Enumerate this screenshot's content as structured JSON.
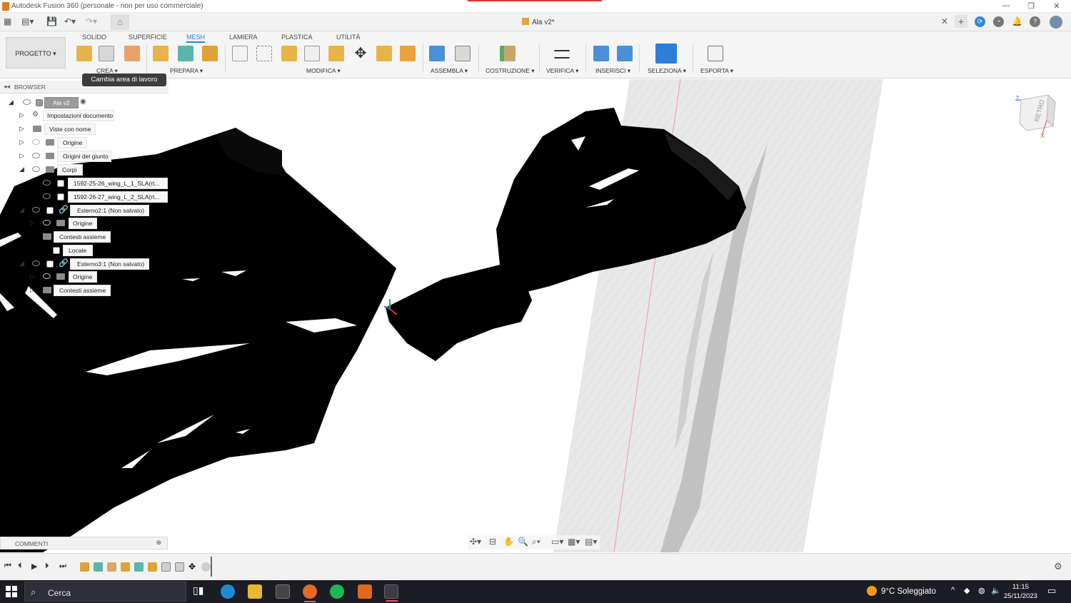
{
  "window": {
    "title": "Autodesk Fusion 360 (personale - non per uso commerciale)",
    "minimize": "—",
    "restore": "❐",
    "close": "✕"
  },
  "tabs": {
    "document_tab": "Ala v2*",
    "close": "✕",
    "plus": "+"
  },
  "ribbon": {
    "project_button": "PROGETTO ▾",
    "workspace_tabs": [
      "SOLIDO",
      "SUPERFICIE",
      "MESH",
      "LAMIERA",
      "PLASTICA",
      "UTILITÀ"
    ],
    "active_tab": "MESH",
    "groups": [
      "CREA ▾",
      "PREPARA ▾",
      "MODIFICA ▾",
      "ASSEMBLA ▾",
      "COSTRUZIONE ▾",
      "VERIFICA ▾",
      "INSERISCI ▾",
      "SELEZIONA ▾",
      "ESPORTA ▾"
    ],
    "tooltip": "Cambia area di lavoro"
  },
  "browser": {
    "title": "BROWSER",
    "items": [
      {
        "label": "Ala v2"
      },
      {
        "label": "Impostazioni documento"
      },
      {
        "label": "Viste con nome"
      },
      {
        "label": "Origine"
      },
      {
        "label": "Origini del giunto"
      },
      {
        "label": "Corpi"
      },
      {
        "label": "1592-25-26_wing_L_1_SLA(rt..."
      },
      {
        "label": "1592-26-27_wing_L_2_SLA(rt..."
      },
      {
        "label": "Esterno2:1 (Non salvato)"
      },
      {
        "label": "Origine"
      },
      {
        "label": "Contesti assieme"
      },
      {
        "label": "Locale"
      },
      {
        "label": "Esterno3:1 (Non salvato)"
      },
      {
        "label": "Origine"
      },
      {
        "label": "Contesti assieme"
      }
    ]
  },
  "comments": {
    "label": "COMMENTI"
  },
  "viewcube": {
    "face": "RETRO",
    "axis_z": "Z",
    "axis_x": "X"
  },
  "taskbar": {
    "search_placeholder": "Cerca",
    "weather": "9°C Soleggiato",
    "time": "11:15",
    "date": "25/11/2023"
  },
  "colors": {
    "accent": "#2d7ed8",
    "mesh": "#000000",
    "plane": "#e6e6e6",
    "taskbar": "#1c1c24"
  }
}
